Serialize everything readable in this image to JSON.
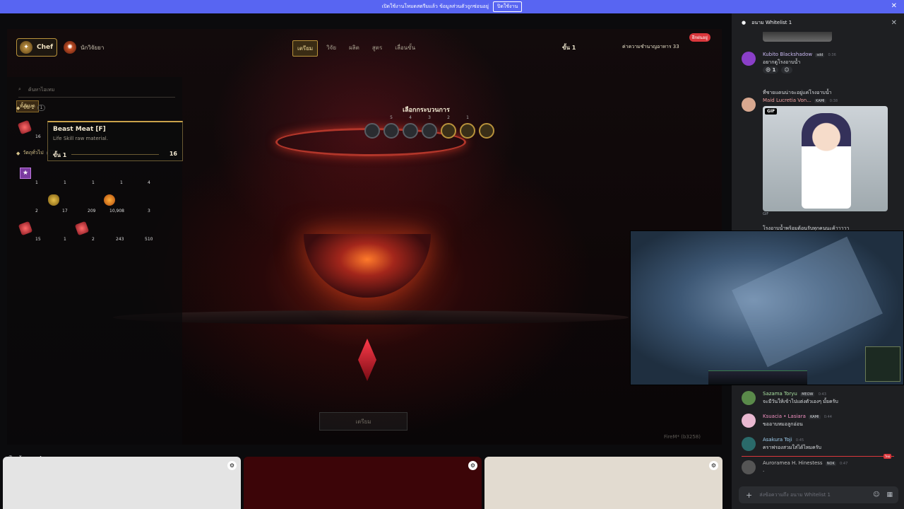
{
  "banner": {
    "text": "เปิดใช้งานโหมดสตรีมแล้ว ข้อมูลส่วนตัวถูกซ่อนอยู่",
    "button": "ปิดใช้งาน",
    "close": "✕"
  },
  "game": {
    "chef_label": "Chef",
    "scientist_label": "นักวิจัยยา",
    "tabs": [
      "เตรียม",
      "วิจัย",
      "ผลิต",
      "สูตร",
      "เลื่อนขั้น"
    ],
    "active_tab": "เตรียม",
    "level_label": "ขั้น 1",
    "reputation_label": "ค่าความชำนาญอาหาร 33",
    "badge": "ฝึกฝนอยู่",
    "search_placeholder": "ค้นหาไอเทม",
    "all_button": "ทั้งหมด",
    "tier1": {
      "label": "ขั้น 1",
      "count": "1"
    },
    "tier2": {
      "label": "วัตถุทั่วไป",
      "count": "15"
    },
    "tooltip": {
      "title": "Beast Meat [F]",
      "desc": "Life Skill raw material.",
      "tier": "ขั้น 1",
      "qty": "16"
    },
    "item_qty_meat": "16",
    "grid_row1": [
      "1",
      "1",
      "1",
      "1",
      "4"
    ],
    "grid_row2": [
      "2",
      "17",
      "209",
      "10,908",
      "3"
    ],
    "grid_row3": [
      "15",
      "1",
      "2",
      "243",
      "510"
    ],
    "cook_title": "เลือกกระบวนการ",
    "slot_numbers": [
      "5",
      "4",
      "3",
      "2",
      "1"
    ],
    "prepare_button": "เตรียม",
    "footer_id": "FireM* (b3258)"
  },
  "voice": {
    "speakers_label": "ผู้พูด — 4",
    "tile_colors": [
      "#e4e4e4",
      "#3c0508",
      "#e2dbd0"
    ]
  },
  "chat": {
    "channel": "อนาม Whitelist 1",
    "messages": [
      {
        "name": "Kubito Blackshadow",
        "tag": "sdd",
        "time": "0:36",
        "text": "อยากดูโรงอาบน้ำ",
        "reactions": [
          "1"
        ],
        "color": "#c9b8f0"
      },
      {
        "name": "",
        "text": "ที่ชายแดนน่าจะอยู่แค่โรงอาบน้ำ"
      },
      {
        "name": "Maid Lucretia Von...",
        "tag": "KAMI",
        "time": "0:38",
        "color": "#f0a0a0"
      },
      {
        "name": "",
        "text": "โรงอาบน้ำพร้อมต้อนรับทุกคนนะค้าาาาา"
      },
      {
        "name": "Sazama Toryu",
        "tag": "MEOW",
        "time": "0:43",
        "text": "จะมีวันให้เข้าไปแต่งตัวเองๆ มั้ยครับ",
        "color": "#a8e0a0"
      },
      {
        "name": "Ksuacia • Lasiara",
        "tag": "KAMI",
        "time": "0:44",
        "text": "ขออาบหมอลูกอ่อน",
        "color": "#f090c0"
      },
      {
        "name": "Asakura Toji",
        "time": "0:45",
        "text": "คราฟรองสวมใส่ได้ไหมครับ",
        "color": "#a0d0f0"
      },
      {
        "name": "Auroramea H. Hinestess",
        "tag": "NOK",
        "time": "0:47",
        "text": ".",
        "color": "#c0c0c0"
      }
    ],
    "gif_label": "GIF",
    "gif_caption": "GIF",
    "new_tag": "ใหม่",
    "input_placeholder": "ส่งข้อความถึง อนาม Whitelist 1"
  }
}
